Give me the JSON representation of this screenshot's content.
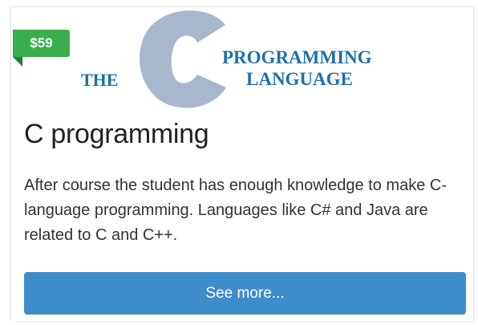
{
  "card": {
    "price": "$59",
    "logo": {
      "word_the": "THE",
      "big_letter": "C",
      "word_programming": "PROGRAMMING",
      "word_language": "LANGUAGE"
    },
    "title": "C programming",
    "description": "After course the student has enough knowledge to make C-language programming. Languages like C# and Java are related to C and C++.",
    "button_label": "See more..."
  },
  "colors": {
    "price_badge": "#3aad4d",
    "button": "#3f8ccb",
    "logo_text": "#1f6fad",
    "logo_c": "#a8b7cc"
  }
}
